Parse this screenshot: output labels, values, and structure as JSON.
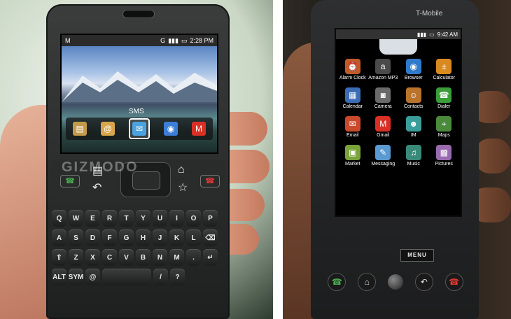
{
  "left_phone": {
    "status": {
      "email_icon": "M",
      "g_badge": "G",
      "time": "2:28 PM"
    },
    "home_label": "SMS",
    "dock": [
      {
        "icon": "folder-icon",
        "glyph": "▤",
        "color": "#c49a4a"
      },
      {
        "icon": "at-icon",
        "glyph": "@",
        "color": "#d8a64a"
      },
      {
        "icon": "sms-icon",
        "glyph": "✉",
        "color": "#4aa3e0"
      },
      {
        "icon": "globe-icon",
        "glyph": "◉",
        "color": "#3b7dd8"
      },
      {
        "icon": "gmail-icon",
        "glyph": "M",
        "color": "#d93025"
      }
    ],
    "watermark": "GIZMODO",
    "keyboard": [
      [
        "Q",
        "W",
        "E",
        "R",
        "T",
        "Y",
        "U",
        "I",
        "O",
        "P"
      ],
      [
        "A",
        "S",
        "D",
        "F",
        "G",
        "H",
        "J",
        "K",
        "L",
        "⌫"
      ],
      [
        "⇧",
        "Z",
        "X",
        "C",
        "V",
        "B",
        "N",
        "M",
        ".",
        "↵"
      ],
      [
        "ALT",
        "SYM",
        "@",
        "",
        "",
        "/",
        "?"
      ]
    ]
  },
  "right_phone": {
    "brand": "T-Mobile",
    "status_time": "9:42 AM",
    "apps": [
      {
        "label": "Alarm Clock",
        "icon": "alarm-clock-icon",
        "glyph": "⏰",
        "color": "#c05a2a"
      },
      {
        "label": "Amazon MP3",
        "icon": "amazon-icon",
        "glyph": "a",
        "color": "#4a4a4a"
      },
      {
        "label": "Browser",
        "icon": "browser-icon",
        "glyph": "◉",
        "color": "#2f7ac9"
      },
      {
        "label": "Calculator",
        "icon": "calculator-icon",
        "glyph": "±",
        "color": "#d98a1e"
      },
      {
        "label": "Calendar",
        "icon": "calendar-icon",
        "glyph": "▦",
        "color": "#3a6db5"
      },
      {
        "label": "Camera",
        "icon": "camera-icon",
        "glyph": "◙",
        "color": "#6a6a6a"
      },
      {
        "label": "Contacts",
        "icon": "contacts-icon",
        "glyph": "☺",
        "color": "#b9732a"
      },
      {
        "label": "Dialer",
        "icon": "dialer-icon",
        "glyph": "☎",
        "color": "#3a9d3a"
      },
      {
        "label": "Email",
        "icon": "email-icon",
        "glyph": "✉",
        "color": "#c94a2a"
      },
      {
        "label": "Gmail",
        "icon": "gmail-icon",
        "glyph": "M",
        "color": "#d93025"
      },
      {
        "label": "IM",
        "icon": "im-icon",
        "glyph": "☻",
        "color": "#3a9d9a"
      },
      {
        "label": "Maps",
        "icon": "maps-icon",
        "glyph": "⌖",
        "color": "#4a8a3a"
      },
      {
        "label": "Market",
        "icon": "market-icon",
        "glyph": "▣",
        "color": "#7aa33a"
      },
      {
        "label": "Messaging",
        "icon": "messaging-icon",
        "glyph": "✎",
        "color": "#5a9ad0"
      },
      {
        "label": "Music",
        "icon": "music-icon",
        "glyph": "♫",
        "color": "#3a8a7a"
      },
      {
        "label": "Pictures",
        "icon": "pictures-icon",
        "glyph": "▩",
        "color": "#9a6ab0"
      }
    ],
    "menu_label": "MENU"
  }
}
